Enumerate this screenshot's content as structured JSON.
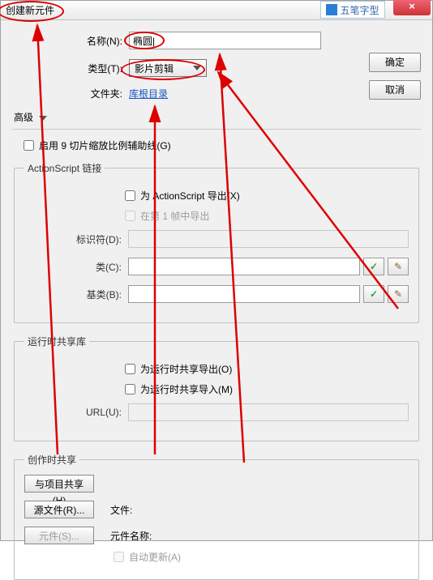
{
  "titlebar": {
    "title": "创建新元件",
    "ime": "五笔字型",
    "close": "×"
  },
  "buttons": {
    "ok": "确定",
    "cancel": "取消"
  },
  "labels": {
    "name": "名称(N):",
    "type": "类型(T):",
    "folder": "文件夹:",
    "advanced": "高级"
  },
  "values": {
    "name": "椭圆|",
    "type": "影片剪辑",
    "folder_link": "库根目录"
  },
  "slice9": {
    "label": "启用 9 切片缩放比例辅助线(G)"
  },
  "aslink": {
    "legend": "ActionScript 链接",
    "export_as": "为 ActionScript 导出(X)",
    "export_frame1": "在第 1 帧中导出",
    "ident": "标识符(D):",
    "class": "类(C):",
    "base": "基类(B):"
  },
  "shared": {
    "legend": "运行时共享库",
    "export": "为运行时共享导出(O)",
    "import": "为运行时共享导入(M)",
    "url": "URL(U):"
  },
  "author": {
    "legend": "创作时共享",
    "share_project": "与项目共享(H)",
    "source_btn": "源文件(R)...",
    "symbol_btn": "元件(S)...",
    "file": "文件:",
    "symbol_name": "元件名称:",
    "auto_update": "自动更新(A)"
  }
}
